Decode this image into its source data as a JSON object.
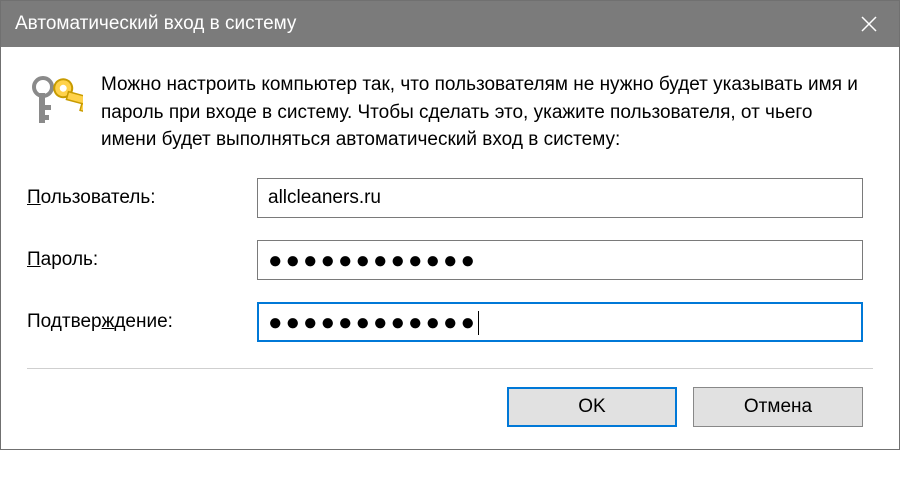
{
  "titlebar": {
    "title": "Автоматический вход в систему"
  },
  "intro": {
    "text": "Можно настроить компьютер так, что пользователям не нужно будет указывать имя и пароль при входе в систему. Чтобы сделать это, укажите пользователя, от чьего имени будет выполняться автоматический вход в систему:"
  },
  "form": {
    "user_label_u": "П",
    "user_label_rest": "ользователь:",
    "password_label_u": "П",
    "password_label_rest": "ароль:",
    "confirm_prefix": "Подтвер",
    "confirm_u": "ж",
    "confirm_rest": "дение:",
    "username_value": "allcleaners.ru",
    "password_mask": "●●●●●●●●●●●●",
    "confirm_mask": "●●●●●●●●●●●●"
  },
  "footer": {
    "ok_label": "OK",
    "cancel_label": "Отмена"
  }
}
